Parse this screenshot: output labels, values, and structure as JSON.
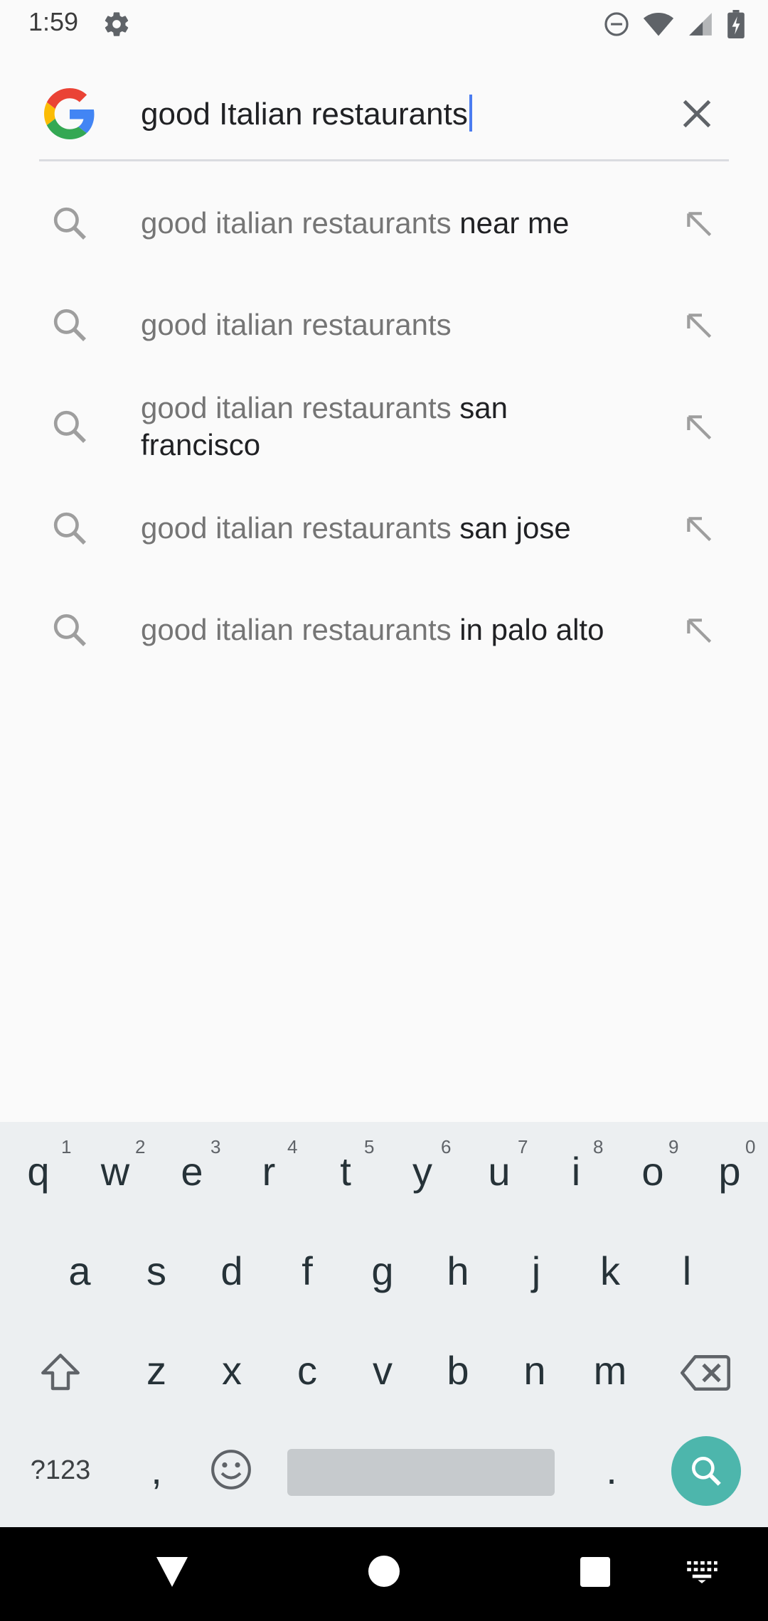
{
  "status_bar": {
    "time": "1:59",
    "icons": [
      "settings-icon",
      "do-not-disturb-icon",
      "wifi-icon",
      "signal-icon",
      "battery-charging-icon"
    ]
  },
  "search": {
    "query": "good Italian restaurants",
    "logo": "google-g-logo",
    "clear_icon": "close-icon"
  },
  "suggestions": [
    {
      "prefix": "good italian restaurants",
      "suffix": " near me"
    },
    {
      "prefix": "good italian restaurants",
      "suffix": ""
    },
    {
      "prefix": "good italian restaurants",
      "suffix": " san francisco"
    },
    {
      "prefix": "good italian restaurants",
      "suffix": " san jose"
    },
    {
      "prefix": "good italian restaurants",
      "suffix": " in palo alto"
    }
  ],
  "keyboard": {
    "row1": [
      {
        "k": "q",
        "n": "1"
      },
      {
        "k": "w",
        "n": "2"
      },
      {
        "k": "e",
        "n": "3"
      },
      {
        "k": "r",
        "n": "4"
      },
      {
        "k": "t",
        "n": "5"
      },
      {
        "k": "y",
        "n": "6"
      },
      {
        "k": "u",
        "n": "7"
      },
      {
        "k": "i",
        "n": "8"
      },
      {
        "k": "o",
        "n": "9"
      },
      {
        "k": "p",
        "n": "0"
      }
    ],
    "row2": [
      "a",
      "s",
      "d",
      "f",
      "g",
      "h",
      "j",
      "k",
      "l"
    ],
    "row3": [
      "z",
      "x",
      "c",
      "v",
      "b",
      "n",
      "m"
    ],
    "symbols_label": "?123",
    "comma": ",",
    "period": "."
  },
  "colors": {
    "accent": "#4db6ac",
    "caret": "#4a7cf0",
    "keyboard_bg": "#eceff1"
  }
}
